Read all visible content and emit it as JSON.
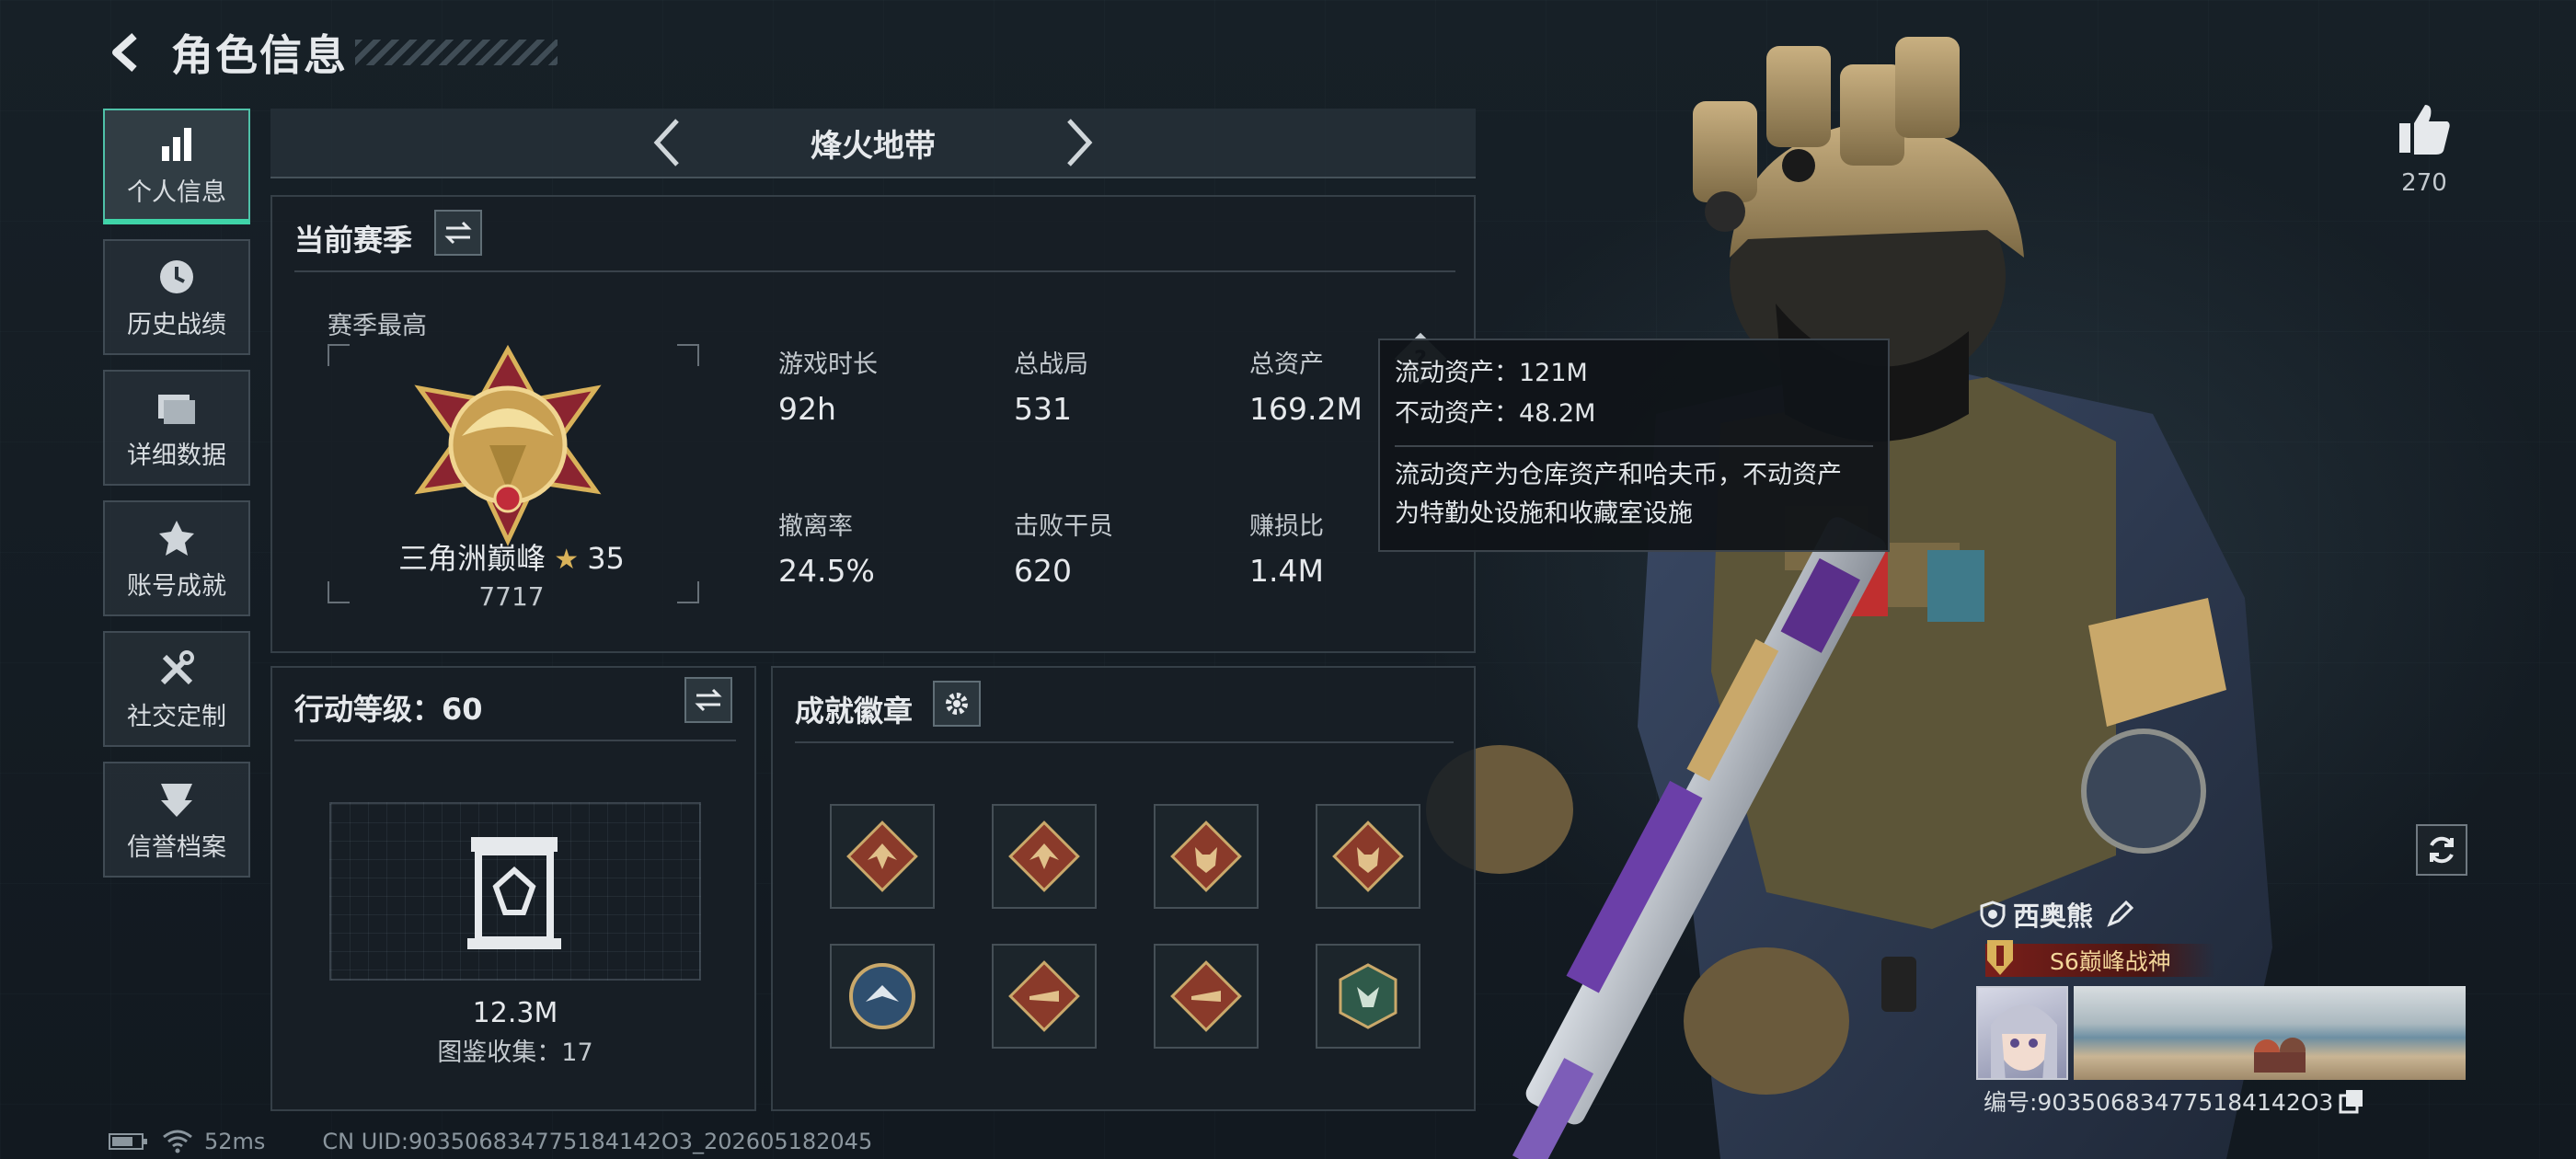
{
  "header": {
    "title": "角色信息"
  },
  "nav": [
    {
      "label": "个人信息",
      "icon": "bar-chart-icon",
      "active": true
    },
    {
      "label": "历史战绩",
      "icon": "history-clock-icon",
      "active": false
    },
    {
      "label": "详细数据",
      "icon": "folder-icon",
      "active": false
    },
    {
      "label": "账号成就",
      "icon": "achievement-icon",
      "active": false
    },
    {
      "label": "社交定制",
      "icon": "tools-icon",
      "active": false
    },
    {
      "label": "信誉档案",
      "icon": "credit-shield-icon",
      "active": false
    }
  ],
  "mode": {
    "title": "烽火地带"
  },
  "season": {
    "title": "当前赛季",
    "best_label": "赛季最高",
    "rank_name": "三角洲巅峰",
    "rank_stars": "35",
    "rank_score": "7717",
    "stats": [
      {
        "label": "游戏时长",
        "value": "92h"
      },
      {
        "label": "总战局",
        "value": "531"
      },
      {
        "label": "总资产",
        "value": "169.2M"
      },
      {
        "label": "撤离率",
        "value": "24.5%"
      },
      {
        "label": "击败干员",
        "value": "620"
      },
      {
        "label": "赚损比",
        "value": "1.4M"
      }
    ]
  },
  "tooltip": {
    "liquid": "流动资产：121M",
    "fixed": "不动资产：48.2M",
    "desc_line1": "流动资产为仓库资产和哈夫币，不动资产",
    "desc_line2": "为特勤处设施和收藏室设施"
  },
  "action": {
    "title": "行动等级：60",
    "value": "12.3M",
    "collection": "图鉴收集：17"
  },
  "badges": {
    "title": "成就徽章",
    "items": [
      {
        "icon": "dragon-badge-icon",
        "color": "#8a3a2a"
      },
      {
        "icon": "dragon-badge-icon",
        "color": "#8a3a2a"
      },
      {
        "icon": "wolf-badge-icon",
        "color": "#8a3a2a"
      },
      {
        "icon": "wolf-badge-icon",
        "color": "#8a3a2a"
      },
      {
        "icon": "eagle-badge-icon",
        "color": "#2f4f6f"
      },
      {
        "icon": "croc-badge-icon",
        "color": "#8a3a2a"
      },
      {
        "icon": "croc-badge-icon",
        "color": "#8a3a2a"
      },
      {
        "icon": "hornet-badge-icon",
        "color": "#2f5a4a"
      }
    ]
  },
  "likes": {
    "count": "270"
  },
  "player": {
    "name": "西奥熊",
    "title_badge": "S6巅峰战神",
    "id_text": "编号:903506834775184142O3"
  },
  "footer": {
    "latency": "52ms",
    "uid": "CN UID:903506834775184142O3_202605182045"
  },
  "colors": {
    "accent": "#3fd4a8",
    "gold": "#d9b25a",
    "panel_bg": "#181f25"
  }
}
